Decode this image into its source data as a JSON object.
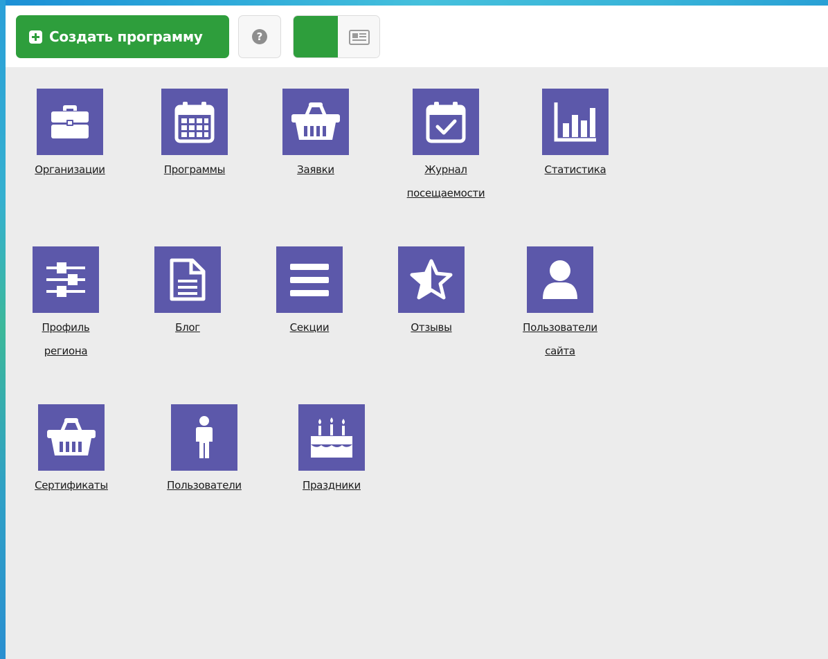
{
  "toolbar": {
    "create_label": "Создать программу",
    "help_glyph": "?",
    "icons": {
      "create": "plus-square-icon",
      "help": "question-circle-icon",
      "add": "plus-square-icon",
      "list_view": "newspaper-icon"
    }
  },
  "colors": {
    "accent_green": "#2e9e3c",
    "tile_purple": "#5c58aa",
    "panel_background": "#ececec"
  },
  "tiles": [
    {
      "label": "Организации",
      "icon": "briefcase-icon"
    },
    {
      "label": "Программы",
      "icon": "calendar-icon"
    },
    {
      "label": "Заявки",
      "icon": "basket-icon"
    },
    {
      "label": "Журнал\nпосещаемости",
      "icon": "calendar-check-icon"
    },
    {
      "label": "Статистика",
      "icon": "bar-chart-icon"
    },
    {
      "label": "Профиль\nрегиона",
      "icon": "sliders-icon"
    },
    {
      "label": "Блог",
      "icon": "document-icon"
    },
    {
      "label": "Секции",
      "icon": "menu-lines-icon"
    },
    {
      "label": "Отзывы",
      "icon": "star-half-icon"
    },
    {
      "label": "Пользователи\nсайта",
      "icon": "user-icon"
    },
    {
      "label": "Сертификаты",
      "icon": "basket-icon"
    },
    {
      "label": "Пользователи",
      "icon": "person-icon"
    },
    {
      "label": "Праздники",
      "icon": "birthday-cake-icon"
    }
  ]
}
